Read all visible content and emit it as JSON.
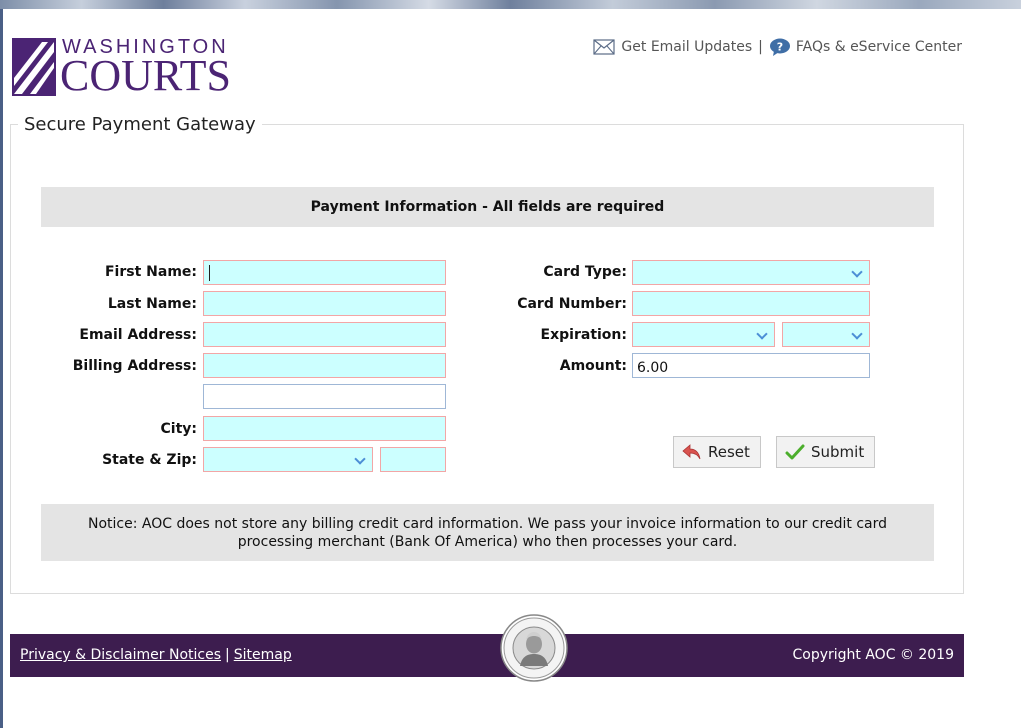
{
  "header": {
    "logo_line1": "WASHINGTON",
    "logo_line2": "COURTS",
    "email_updates": "Get Email Updates",
    "separator": "|",
    "faqs": "FAQs & eService Center"
  },
  "gateway": {
    "title": "Secure Payment Gateway",
    "section_heading": "Payment Information - All fields are required"
  },
  "form": {
    "first_name_label": "First Name:",
    "last_name_label": "Last Name:",
    "email_label": "Email Address:",
    "billing_label": "Billing Address:",
    "city_label": "City:",
    "state_zip_label": "State & Zip:",
    "card_type_label": "Card Type:",
    "card_number_label": "Card Number:",
    "expiration_label": "Expiration:",
    "amount_label": "Amount:",
    "amount_value": "6.00",
    "first_name_value": "",
    "last_name_value": "",
    "email_value": "",
    "billing1_value": "",
    "billing2_value": "",
    "city_value": "",
    "zip_value": "",
    "card_number_value": ""
  },
  "buttons": {
    "reset": "Reset",
    "submit": "Submit"
  },
  "notice": "Notice: AOC does not store any billing credit card information. We pass your invoice information to our credit card processing merchant (Bank Of America) who then processes your card.",
  "footer": {
    "privacy": "Privacy & Disclaimer Notices",
    "pipe": "|",
    "sitemap": "Sitemap",
    "copyright": "Copyright AOC © 2019"
  },
  "colors": {
    "brand_purple": "#4b2474",
    "footer_bg": "#3d1d4f",
    "required_field_bg": "#ccffff",
    "required_field_border": "#f2a6a6",
    "panel_gray": "#e4e4e4"
  },
  "icons": {
    "email": "envelope-icon",
    "faq": "question-bubble-icon",
    "reset": "undo-arrow-icon",
    "submit": "checkmark-icon",
    "seal": "state-seal-icon"
  }
}
